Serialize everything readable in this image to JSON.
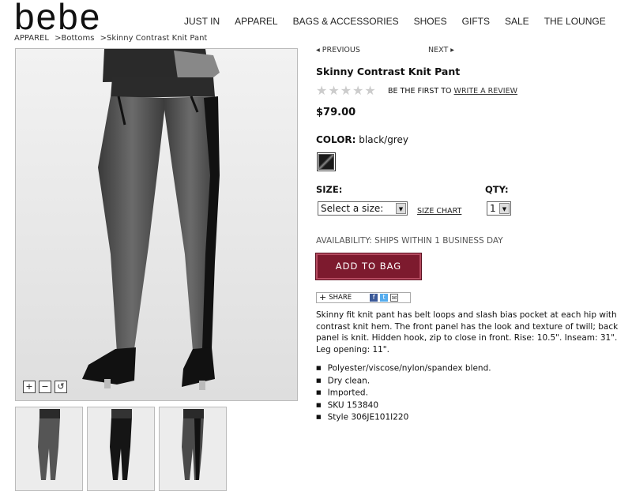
{
  "brand": "bebe",
  "nav": [
    "JUST IN",
    "APPAREL",
    "BAGS & ACCESSORIES",
    "SHOES",
    "GIFTS",
    "SALE",
    "THE LOUNGE"
  ],
  "breadcrumb": [
    "APPAREL",
    ">Bottoms",
    ">Skinny Contrast Knit Pant"
  ],
  "pager": {
    "prev": "◂ PREVIOUS",
    "next": "NEXT ▸"
  },
  "product": {
    "title": "Skinny Contrast Knit Pant",
    "rating_text": "BE THE FIRST TO",
    "rating_link": "WRITE A REVIEW",
    "price": "$79.00",
    "color_label": "COLOR:",
    "color_value": "black/grey",
    "size_label": "SIZE:",
    "size_select": "Select a size:",
    "size_chart": "SIZE CHART",
    "qty_label": "QTY:",
    "qty_value": "1",
    "availability": "AVAILABILITY: SHIPS WITHIN 1 BUSINESS DAY",
    "add_to_bag": "ADD TO BAG",
    "share": "SHARE",
    "description": "Skinny fit knit pant has belt loops and slash bias pocket at each hip with contrast knit hem. The front panel has the look and texture of twill; back panel is knit. Hidden hook, zip to close in front. Rise: 10.5\". Inseam: 31\". Leg opening: 11\".",
    "bullets": [
      "Polyester/viscose/nylon/spandex blend.",
      "Dry clean.",
      "Imported.",
      "SKU 153840",
      "Style 306JE101I220"
    ]
  },
  "zoom": [
    "+",
    "−",
    "↺"
  ],
  "colors": {
    "brand": "#7d1a2e",
    "facebook": "#3b5998",
    "twitter": "#55acee"
  }
}
